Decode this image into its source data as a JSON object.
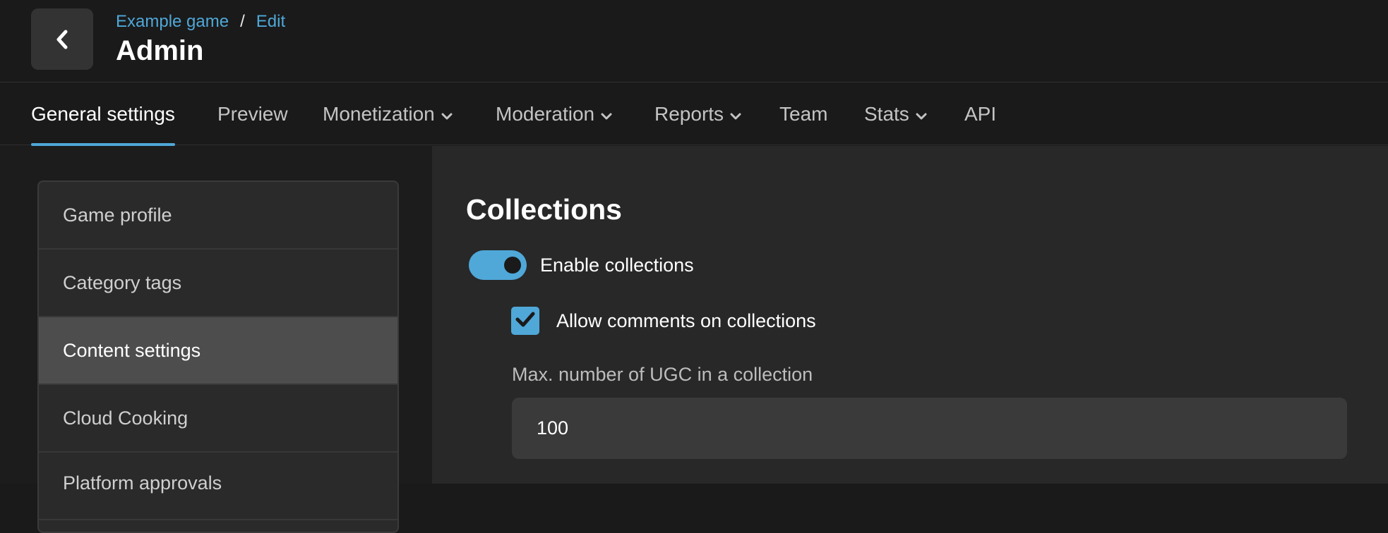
{
  "header": {
    "back_icon": "chevron-left-icon",
    "breadcrumb": [
      {
        "label": "Example game"
      },
      {
        "label": "Edit"
      }
    ],
    "breadcrumb_separator": "/",
    "title": "Admin"
  },
  "tabs": [
    {
      "label": "General settings",
      "active": true,
      "has_dropdown": false
    },
    {
      "label": "Preview",
      "active": false,
      "has_dropdown": false
    },
    {
      "label": "Monetization",
      "active": false,
      "has_dropdown": true
    },
    {
      "label": "Moderation",
      "active": false,
      "has_dropdown": true
    },
    {
      "label": "Reports",
      "active": false,
      "has_dropdown": true
    },
    {
      "label": "Team",
      "active": false,
      "has_dropdown": false
    },
    {
      "label": "Stats",
      "active": false,
      "has_dropdown": true
    },
    {
      "label": "API",
      "active": false,
      "has_dropdown": false
    }
  ],
  "sidebar": {
    "items": [
      {
        "label": "Game profile",
        "selected": false
      },
      {
        "label": "Category tags",
        "selected": false
      },
      {
        "label": "Content settings",
        "selected": true
      },
      {
        "label": "Cloud Cooking",
        "selected": false
      },
      {
        "label": "Platform approvals",
        "selected": false
      }
    ]
  },
  "content": {
    "section_title": "Collections",
    "enable_toggle": {
      "label": "Enable collections",
      "on": true
    },
    "allow_comments": {
      "label": "Allow comments on collections",
      "checked": true
    },
    "max_ugc": {
      "label": "Max. number of UGC in a collection",
      "value": "100"
    }
  },
  "colors": {
    "accent": "#4fa8d8",
    "background": "#1a1a1a",
    "panel": "#282828",
    "selected_item": "#4d4d4d"
  }
}
